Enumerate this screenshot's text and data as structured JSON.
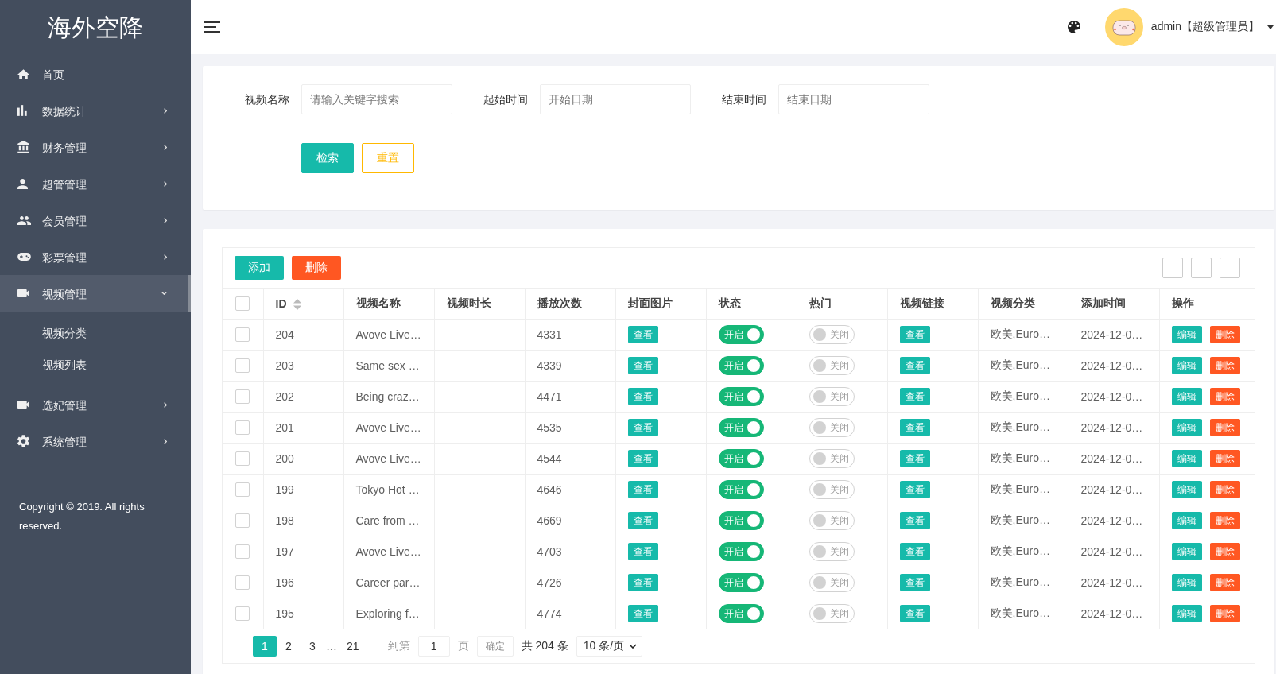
{
  "sidebar": {
    "logo": "海外空降",
    "menu": [
      {
        "label": "首页",
        "kind": "link"
      },
      {
        "label": "数据统计",
        "kind": "menu",
        "expanded": false
      },
      {
        "label": "财务管理",
        "kind": "menu",
        "expanded": false
      },
      {
        "label": "超管管理",
        "kind": "menu",
        "expanded": false
      },
      {
        "label": "会员管理",
        "kind": "menu",
        "expanded": false
      },
      {
        "label": "彩票管理",
        "kind": "menu",
        "expanded": false
      },
      {
        "label": "视频管理",
        "kind": "menu",
        "expanded": true,
        "children": [
          {
            "label": "视频分类",
            "selected": false
          },
          {
            "label": "视频列表",
            "selected": false
          }
        ]
      },
      {
        "label": "选妃管理",
        "kind": "menu",
        "expanded": false
      },
      {
        "label": "系统管理",
        "kind": "menu",
        "expanded": false
      }
    ],
    "copyright": "Copyright © 2019. All rights reserved."
  },
  "header": {
    "user": "admin【超级管理员】"
  },
  "search": {
    "fields": [
      {
        "label": "视频名称",
        "placeholder": "请输入关键字搜索"
      },
      {
        "label": "起始时间",
        "placeholder": "开始日期"
      },
      {
        "label": "结束时间",
        "placeholder": "结束日期"
      }
    ],
    "buttons": [
      {
        "label": "检索",
        "kind": "search"
      },
      {
        "label": "重置",
        "kind": "reset"
      }
    ]
  },
  "table": {
    "toolbar": [
      {
        "label": "添加",
        "kind": "add"
      },
      {
        "label": "删除",
        "kind": "delete"
      }
    ],
    "header_checked": false,
    "columns": [
      {
        "label": "ID",
        "sortable": true
      },
      {
        "label": "视频名称",
        "sortable": false
      },
      {
        "label": "视频时长",
        "sortable": false
      },
      {
        "label": "播放次数",
        "sortable": false
      },
      {
        "label": "封面图片",
        "sortable": false
      },
      {
        "label": "状态",
        "sortable": false
      },
      {
        "label": "热门",
        "sortable": false
      },
      {
        "label": "视频链接",
        "sortable": false
      },
      {
        "label": "视频分类",
        "sortable": false
      },
      {
        "label": "添加时间",
        "sortable": false
      },
      {
        "label": "操作",
        "sortable": false
      }
    ],
    "rows": [
      {
        "checked": false,
        "id": "204",
        "name": "Avove Live…",
        "plays": "4331",
        "cover": "查看",
        "status": {
          "on": true,
          "label": "开启"
        },
        "hot": {
          "on": false,
          "label": "关闭"
        },
        "link": "查看",
        "category": "欧美,Euro…",
        "added": "2024-12-0…",
        "actions": [
          {
            "label": "编辑",
            "kind": "edit"
          },
          {
            "label": "删除",
            "kind": "delete"
          }
        ]
      },
      {
        "checked": false,
        "id": "203",
        "name": "Same sex …",
        "plays": "4339",
        "cover": "查看",
        "status": {
          "on": true,
          "label": "开启"
        },
        "hot": {
          "on": false,
          "label": "关闭"
        },
        "link": "查看",
        "category": "欧美,Euro…",
        "added": "2024-12-0…",
        "actions": [
          {
            "label": "编辑",
            "kind": "edit"
          },
          {
            "label": "删除",
            "kind": "delete"
          }
        ]
      },
      {
        "checked": false,
        "id": "202",
        "name": "Being craz…",
        "plays": "4471",
        "cover": "查看",
        "status": {
          "on": true,
          "label": "开启"
        },
        "hot": {
          "on": false,
          "label": "关闭"
        },
        "link": "查看",
        "category": "欧美,Euro…",
        "added": "2024-12-0…",
        "actions": [
          {
            "label": "编辑",
            "kind": "edit"
          },
          {
            "label": "删除",
            "kind": "delete"
          }
        ]
      },
      {
        "checked": false,
        "id": "201",
        "name": "Avove Live…",
        "plays": "4535",
        "cover": "查看",
        "status": {
          "on": true,
          "label": "开启"
        },
        "hot": {
          "on": false,
          "label": "关闭"
        },
        "link": "查看",
        "category": "欧美,Euro…",
        "added": "2024-12-0…",
        "actions": [
          {
            "label": "编辑",
            "kind": "edit"
          },
          {
            "label": "删除",
            "kind": "delete"
          }
        ]
      },
      {
        "checked": false,
        "id": "200",
        "name": "Avove Live…",
        "plays": "4544",
        "cover": "查看",
        "status": {
          "on": true,
          "label": "开启"
        },
        "hot": {
          "on": false,
          "label": "关闭"
        },
        "link": "查看",
        "category": "欧美,Euro…",
        "added": "2024-12-0…",
        "actions": [
          {
            "label": "编辑",
            "kind": "edit"
          },
          {
            "label": "删除",
            "kind": "delete"
          }
        ]
      },
      {
        "checked": false,
        "id": "199",
        "name": "Tokyo Hot …",
        "plays": "4646",
        "cover": "查看",
        "status": {
          "on": true,
          "label": "开启"
        },
        "hot": {
          "on": false,
          "label": "关闭"
        },
        "link": "查看",
        "category": "欧美,Euro…",
        "added": "2024-12-0…",
        "actions": [
          {
            "label": "编辑",
            "kind": "edit"
          },
          {
            "label": "删除",
            "kind": "delete"
          }
        ]
      },
      {
        "checked": false,
        "id": "198",
        "name": "Care from …",
        "plays": "4669",
        "cover": "查看",
        "status": {
          "on": true,
          "label": "开启"
        },
        "hot": {
          "on": false,
          "label": "关闭"
        },
        "link": "查看",
        "category": "欧美,Euro…",
        "added": "2024-12-0…",
        "actions": [
          {
            "label": "编辑",
            "kind": "edit"
          },
          {
            "label": "删除",
            "kind": "delete"
          }
        ]
      },
      {
        "checked": false,
        "id": "197",
        "name": "Avove Live…",
        "plays": "4703",
        "cover": "查看",
        "status": {
          "on": true,
          "label": "开启"
        },
        "hot": {
          "on": false,
          "label": "关闭"
        },
        "link": "查看",
        "category": "欧美,Euro…",
        "added": "2024-12-0…",
        "actions": [
          {
            "label": "编辑",
            "kind": "edit"
          },
          {
            "label": "删除",
            "kind": "delete"
          }
        ]
      },
      {
        "checked": false,
        "id": "196",
        "name": "Career par…",
        "plays": "4726",
        "cover": "查看",
        "status": {
          "on": true,
          "label": "开启"
        },
        "hot": {
          "on": false,
          "label": "关闭"
        },
        "link": "查看",
        "category": "欧美,Euro…",
        "added": "2024-12-0…",
        "actions": [
          {
            "label": "编辑",
            "kind": "edit"
          },
          {
            "label": "删除",
            "kind": "delete"
          }
        ]
      },
      {
        "checked": false,
        "id": "195",
        "name": "Exploring f…",
        "plays": "4774",
        "cover": "查看",
        "status": {
          "on": true,
          "label": "开启"
        },
        "hot": {
          "on": false,
          "label": "关闭"
        },
        "link": "查看",
        "category": "欧美,Euro…",
        "added": "2024-12-0…",
        "actions": [
          {
            "label": "编辑",
            "kind": "edit"
          },
          {
            "label": "删除",
            "kind": "delete"
          }
        ]
      }
    ]
  },
  "pager": {
    "pages": [
      {
        "label": "1",
        "selected": true
      },
      {
        "label": "2",
        "selected": false
      },
      {
        "label": "3",
        "selected": false
      }
    ],
    "ellipsis": "…",
    "last_page": {
      "label": "21",
      "selected": false
    },
    "goto_label": "到第",
    "goto_value": "1",
    "goto_unit": "页",
    "confirm": "确定",
    "total": "共 204 条",
    "page_size": "10 条/页"
  }
}
